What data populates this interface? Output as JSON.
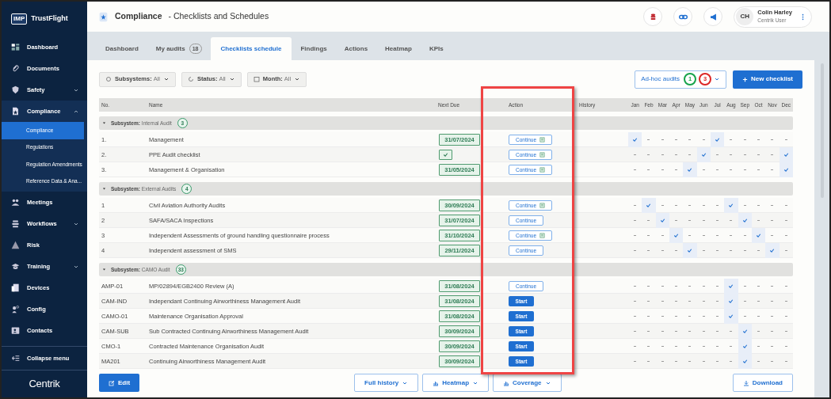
{
  "sidebar": {
    "brand": {
      "logo_text": "IMP",
      "name": "TrustFlight"
    },
    "items": [
      {
        "label": "Dashboard"
      },
      {
        "label": "Documents"
      },
      {
        "label": "Safety",
        "expanded": false
      },
      {
        "label": "Compliance",
        "expanded": true,
        "children": [
          {
            "label": "Compliance",
            "selected": true
          },
          {
            "label": "Regulations",
            "selected": false
          },
          {
            "label": "Regulation Amendments",
            "selected": false
          },
          {
            "label": "Reference Data & Ana...",
            "selected": false
          }
        ]
      },
      {
        "label": "Meetings"
      },
      {
        "label": "Workflows",
        "expanded": false
      },
      {
        "label": "Risk"
      },
      {
        "label": "Training",
        "expanded": false
      },
      {
        "label": "Devices"
      },
      {
        "label": "Config"
      },
      {
        "label": "Contacts"
      }
    ],
    "collapse_label": "Collapse menu",
    "footer_logo": "Centrik"
  },
  "header": {
    "title": "Compliance",
    "subtitle": "- Checklists and Schedules",
    "user": {
      "initials": "CH",
      "name": "Colin Harley",
      "role": "Centrik User"
    }
  },
  "tabs": [
    {
      "label": "Dashboard",
      "selected": false
    },
    {
      "label": "My audits",
      "count": "18",
      "selected": false
    },
    {
      "label": "Checklists schedule",
      "selected": true
    },
    {
      "label": "Findings",
      "selected": false
    },
    {
      "label": "Actions",
      "selected": false
    },
    {
      "label": "Heatmap",
      "selected": false
    },
    {
      "label": "KPIs",
      "selected": false
    }
  ],
  "filters": [
    {
      "label": "Subsystems:",
      "value": "All"
    },
    {
      "label": "Status:",
      "value": "All"
    },
    {
      "label": "Month:",
      "value": "All"
    }
  ],
  "adhoc": {
    "label": "Ad-hoc audits",
    "counts": [
      {
        "text": "1",
        "color": "#16a34a"
      },
      {
        "text": "3",
        "color": "#dc2626"
      }
    ]
  },
  "new_button": "New checklist",
  "table": {
    "columns": [
      "No.",
      "Name",
      "Next Due",
      "Action",
      "History"
    ],
    "months": [
      "Jan",
      "Feb",
      "Mar",
      "Apr",
      "May",
      "Jun",
      "Jul",
      "Aug",
      "Sep",
      "Oct",
      "Nov",
      "Dec"
    ],
    "groups": [
      {
        "label": "Subsystem:",
        "name": "Internal Audit",
        "count": "3",
        "expanded": true,
        "rows": [
          {
            "no": "1.",
            "name": "Management",
            "next_due": {
              "kind": "date",
              "text": "31/07/2024"
            },
            "action": {
              "kind": "continue",
              "label": "Continue",
              "indicator": true
            },
            "schedule": [
              true,
              false,
              false,
              false,
              false,
              false,
              true,
              false,
              false,
              false,
              false,
              false
            ]
          },
          {
            "no": "2.",
            "name": "PPE Audit checklist",
            "next_due": {
              "kind": "done"
            },
            "action": {
              "kind": "continue",
              "label": "Continue",
              "indicator": true
            },
            "schedule": [
              false,
              false,
              false,
              false,
              false,
              true,
              false,
              false,
              false,
              false,
              false,
              true
            ]
          },
          {
            "no": "3.",
            "name": "Management & Organisation",
            "next_due": {
              "kind": "date",
              "text": "31/05/2024"
            },
            "action": {
              "kind": "continue",
              "label": "Continue",
              "indicator": true
            },
            "schedule": [
              false,
              false,
              false,
              false,
              true,
              false,
              false,
              false,
              false,
              false,
              false,
              true
            ]
          }
        ]
      },
      {
        "label": "Subsystem:",
        "name": "External Audits",
        "count": "4",
        "expanded": true,
        "rows": [
          {
            "no": "1",
            "name": "Civil Aviation Authority Audits",
            "next_due": {
              "kind": "date",
              "text": "30/09/2024"
            },
            "action": {
              "kind": "continue",
              "label": "Continue",
              "indicator": true
            },
            "schedule": [
              false,
              true,
              false,
              false,
              false,
              false,
              false,
              true,
              false,
              false,
              false,
              false
            ]
          },
          {
            "no": "2",
            "name": "SAFA/SACA Inspections",
            "next_due": {
              "kind": "date",
              "text": "31/07/2024"
            },
            "action": {
              "kind": "continue",
              "label": "Continue",
              "indicator": false
            },
            "schedule": [
              false,
              false,
              true,
              false,
              false,
              false,
              false,
              false,
              true,
              false,
              false,
              false
            ]
          },
          {
            "no": "3",
            "name": "Independent Assessments of ground handling questionnaire process",
            "next_due": {
              "kind": "date",
              "text": "31/10/2024"
            },
            "action": {
              "kind": "continue",
              "label": "Continue",
              "indicator": true
            },
            "schedule": [
              false,
              false,
              false,
              true,
              false,
              false,
              false,
              false,
              false,
              true,
              false,
              false
            ]
          },
          {
            "no": "4",
            "name": "Independent assessment of SMS",
            "next_due": {
              "kind": "date",
              "text": "29/11/2024"
            },
            "action": {
              "kind": "continue",
              "label": "Continue",
              "indicator": false
            },
            "schedule": [
              false,
              false,
              false,
              false,
              true,
              false,
              false,
              false,
              false,
              false,
              true,
              false
            ]
          }
        ]
      },
      {
        "label": "Subsystem:",
        "name": "CAMO Audit",
        "count": "33",
        "expanded": true,
        "rows": [
          {
            "no": "AMP-01",
            "name": "MP/02894/EGB2400 Review (A)",
            "next_due": {
              "kind": "date",
              "text": "31/08/2024"
            },
            "action": {
              "kind": "continue",
              "label": "Continue",
              "indicator": false
            },
            "schedule": [
              false,
              false,
              false,
              false,
              false,
              false,
              false,
              true,
              false,
              false,
              false,
              false
            ]
          },
          {
            "no": "CAM-IND",
            "name": "Independant Continuing Airworthiness Management Audit",
            "next_due": {
              "kind": "date",
              "text": "31/08/2024"
            },
            "action": {
              "kind": "start",
              "label": "Start"
            },
            "schedule": [
              false,
              false,
              false,
              false,
              false,
              false,
              false,
              true,
              false,
              false,
              false,
              false
            ]
          },
          {
            "no": "CAMO-01",
            "name": "Maintenance Organisation Approval",
            "next_due": {
              "kind": "date",
              "text": "31/08/2024"
            },
            "action": {
              "kind": "start",
              "label": "Start"
            },
            "schedule": [
              false,
              false,
              false,
              false,
              false,
              false,
              false,
              true,
              false,
              false,
              false,
              false
            ]
          },
          {
            "no": "CAM-SUB",
            "name": "Sub Contracted Continuing Airworthiness Management Audit",
            "next_due": {
              "kind": "date",
              "text": "30/09/2024"
            },
            "action": {
              "kind": "start",
              "label": "Start"
            },
            "schedule": [
              false,
              false,
              false,
              false,
              false,
              false,
              false,
              false,
              true,
              false,
              false,
              false
            ]
          },
          {
            "no": "CMO-1",
            "name": "Contracted Maintenance Organisation Audit",
            "next_due": {
              "kind": "date",
              "text": "30/09/2024"
            },
            "action": {
              "kind": "start",
              "label": "Start"
            },
            "schedule": [
              false,
              false,
              false,
              false,
              false,
              false,
              false,
              false,
              true,
              false,
              false,
              false
            ]
          },
          {
            "no": "MA201",
            "name": "Continuing Airworthiness Management Audit",
            "next_due": {
              "kind": "date",
              "text": "30/09/2024"
            },
            "action": {
              "kind": "start",
              "label": "Start"
            },
            "schedule": [
              false,
              false,
              false,
              false,
              false,
              false,
              false,
              false,
              true,
              false,
              false,
              false
            ]
          }
        ]
      }
    ]
  },
  "footer_buttons": {
    "edit": "Edit",
    "views": [
      "Full history",
      "Heatmap",
      "Coverage"
    ],
    "download": "Download"
  },
  "annotation": {
    "kind": "rectangle",
    "color": "#ef4444"
  }
}
